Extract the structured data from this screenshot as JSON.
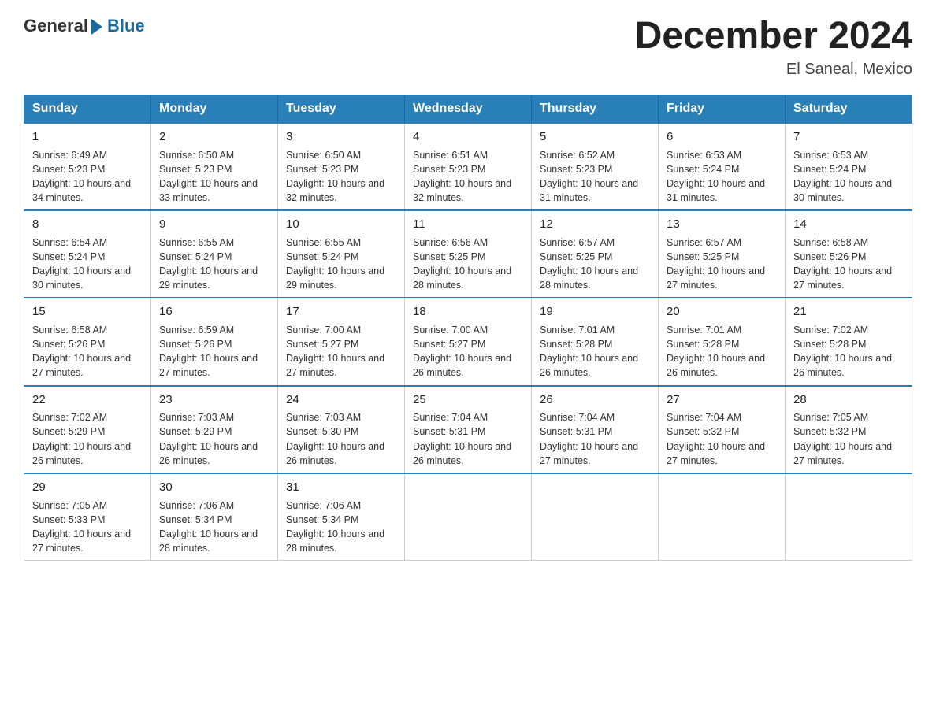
{
  "header": {
    "logo_general": "General",
    "logo_blue": "Blue",
    "month_year": "December 2024",
    "location": "El Saneal, Mexico"
  },
  "weekdays": [
    "Sunday",
    "Monday",
    "Tuesday",
    "Wednesday",
    "Thursday",
    "Friday",
    "Saturday"
  ],
  "weeks": [
    [
      {
        "day": "1",
        "sunrise": "Sunrise: 6:49 AM",
        "sunset": "Sunset: 5:23 PM",
        "daylight": "Daylight: 10 hours and 34 minutes."
      },
      {
        "day": "2",
        "sunrise": "Sunrise: 6:50 AM",
        "sunset": "Sunset: 5:23 PM",
        "daylight": "Daylight: 10 hours and 33 minutes."
      },
      {
        "day": "3",
        "sunrise": "Sunrise: 6:50 AM",
        "sunset": "Sunset: 5:23 PM",
        "daylight": "Daylight: 10 hours and 32 minutes."
      },
      {
        "day": "4",
        "sunrise": "Sunrise: 6:51 AM",
        "sunset": "Sunset: 5:23 PM",
        "daylight": "Daylight: 10 hours and 32 minutes."
      },
      {
        "day": "5",
        "sunrise": "Sunrise: 6:52 AM",
        "sunset": "Sunset: 5:23 PM",
        "daylight": "Daylight: 10 hours and 31 minutes."
      },
      {
        "day": "6",
        "sunrise": "Sunrise: 6:53 AM",
        "sunset": "Sunset: 5:24 PM",
        "daylight": "Daylight: 10 hours and 31 minutes."
      },
      {
        "day": "7",
        "sunrise": "Sunrise: 6:53 AM",
        "sunset": "Sunset: 5:24 PM",
        "daylight": "Daylight: 10 hours and 30 minutes."
      }
    ],
    [
      {
        "day": "8",
        "sunrise": "Sunrise: 6:54 AM",
        "sunset": "Sunset: 5:24 PM",
        "daylight": "Daylight: 10 hours and 30 minutes."
      },
      {
        "day": "9",
        "sunrise": "Sunrise: 6:55 AM",
        "sunset": "Sunset: 5:24 PM",
        "daylight": "Daylight: 10 hours and 29 minutes."
      },
      {
        "day": "10",
        "sunrise": "Sunrise: 6:55 AM",
        "sunset": "Sunset: 5:24 PM",
        "daylight": "Daylight: 10 hours and 29 minutes."
      },
      {
        "day": "11",
        "sunrise": "Sunrise: 6:56 AM",
        "sunset": "Sunset: 5:25 PM",
        "daylight": "Daylight: 10 hours and 28 minutes."
      },
      {
        "day": "12",
        "sunrise": "Sunrise: 6:57 AM",
        "sunset": "Sunset: 5:25 PM",
        "daylight": "Daylight: 10 hours and 28 minutes."
      },
      {
        "day": "13",
        "sunrise": "Sunrise: 6:57 AM",
        "sunset": "Sunset: 5:25 PM",
        "daylight": "Daylight: 10 hours and 27 minutes."
      },
      {
        "day": "14",
        "sunrise": "Sunrise: 6:58 AM",
        "sunset": "Sunset: 5:26 PM",
        "daylight": "Daylight: 10 hours and 27 minutes."
      }
    ],
    [
      {
        "day": "15",
        "sunrise": "Sunrise: 6:58 AM",
        "sunset": "Sunset: 5:26 PM",
        "daylight": "Daylight: 10 hours and 27 minutes."
      },
      {
        "day": "16",
        "sunrise": "Sunrise: 6:59 AM",
        "sunset": "Sunset: 5:26 PM",
        "daylight": "Daylight: 10 hours and 27 minutes."
      },
      {
        "day": "17",
        "sunrise": "Sunrise: 7:00 AM",
        "sunset": "Sunset: 5:27 PM",
        "daylight": "Daylight: 10 hours and 27 minutes."
      },
      {
        "day": "18",
        "sunrise": "Sunrise: 7:00 AM",
        "sunset": "Sunset: 5:27 PM",
        "daylight": "Daylight: 10 hours and 26 minutes."
      },
      {
        "day": "19",
        "sunrise": "Sunrise: 7:01 AM",
        "sunset": "Sunset: 5:28 PM",
        "daylight": "Daylight: 10 hours and 26 minutes."
      },
      {
        "day": "20",
        "sunrise": "Sunrise: 7:01 AM",
        "sunset": "Sunset: 5:28 PM",
        "daylight": "Daylight: 10 hours and 26 minutes."
      },
      {
        "day": "21",
        "sunrise": "Sunrise: 7:02 AM",
        "sunset": "Sunset: 5:28 PM",
        "daylight": "Daylight: 10 hours and 26 minutes."
      }
    ],
    [
      {
        "day": "22",
        "sunrise": "Sunrise: 7:02 AM",
        "sunset": "Sunset: 5:29 PM",
        "daylight": "Daylight: 10 hours and 26 minutes."
      },
      {
        "day": "23",
        "sunrise": "Sunrise: 7:03 AM",
        "sunset": "Sunset: 5:29 PM",
        "daylight": "Daylight: 10 hours and 26 minutes."
      },
      {
        "day": "24",
        "sunrise": "Sunrise: 7:03 AM",
        "sunset": "Sunset: 5:30 PM",
        "daylight": "Daylight: 10 hours and 26 minutes."
      },
      {
        "day": "25",
        "sunrise": "Sunrise: 7:04 AM",
        "sunset": "Sunset: 5:31 PM",
        "daylight": "Daylight: 10 hours and 26 minutes."
      },
      {
        "day": "26",
        "sunrise": "Sunrise: 7:04 AM",
        "sunset": "Sunset: 5:31 PM",
        "daylight": "Daylight: 10 hours and 27 minutes."
      },
      {
        "day": "27",
        "sunrise": "Sunrise: 7:04 AM",
        "sunset": "Sunset: 5:32 PM",
        "daylight": "Daylight: 10 hours and 27 minutes."
      },
      {
        "day": "28",
        "sunrise": "Sunrise: 7:05 AM",
        "sunset": "Sunset: 5:32 PM",
        "daylight": "Daylight: 10 hours and 27 minutes."
      }
    ],
    [
      {
        "day": "29",
        "sunrise": "Sunrise: 7:05 AM",
        "sunset": "Sunset: 5:33 PM",
        "daylight": "Daylight: 10 hours and 27 minutes."
      },
      {
        "day": "30",
        "sunrise": "Sunrise: 7:06 AM",
        "sunset": "Sunset: 5:34 PM",
        "daylight": "Daylight: 10 hours and 28 minutes."
      },
      {
        "day": "31",
        "sunrise": "Sunrise: 7:06 AM",
        "sunset": "Sunset: 5:34 PM",
        "daylight": "Daylight: 10 hours and 28 minutes."
      },
      null,
      null,
      null,
      null
    ]
  ]
}
